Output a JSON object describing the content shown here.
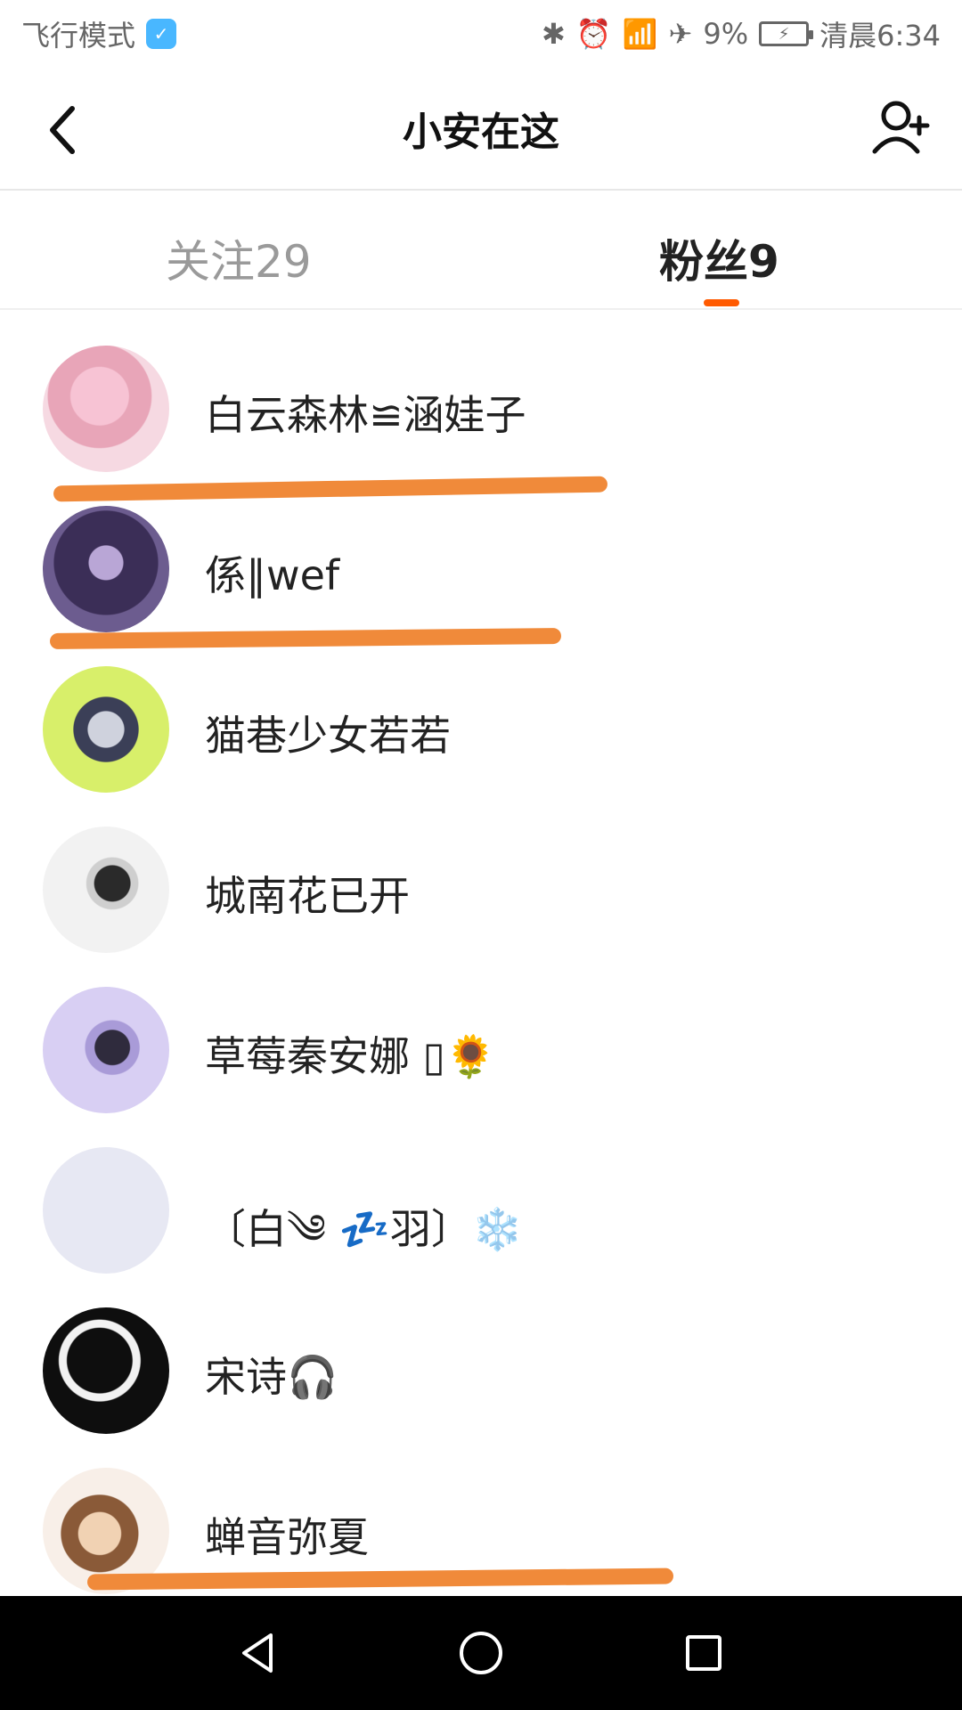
{
  "status_bar": {
    "left_text": "飞行模式",
    "battery_percent": "9%",
    "time_text": "清晨6:34"
  },
  "app_bar": {
    "title": "小安在这"
  },
  "tabs": {
    "following_label": "关注29",
    "fans_label": "粉丝9"
  },
  "fans": [
    {
      "name": "白云森林≌涵娃子"
    },
    {
      "name": "係∥wef"
    },
    {
      "name": "猫巷少女若若"
    },
    {
      "name": "城南花已开"
    },
    {
      "name": "草莓秦安娜 ▯🌻"
    },
    {
      "name": "〔白༄ 💤羽〕❄️"
    },
    {
      "name": "宋诗🎧"
    },
    {
      "name": "蝉音弥夏"
    }
  ],
  "colors": {
    "accent": "#ff5a00",
    "annotation_underline": "#f08a3a"
  }
}
